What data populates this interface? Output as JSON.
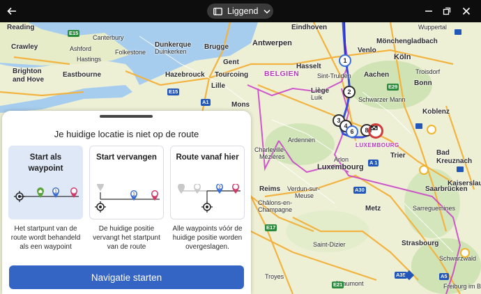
{
  "titlebar": {
    "orientation_label": "Liggend"
  },
  "map": {
    "cities": [
      "Reading",
      "Crawley",
      "Brighton and Hove",
      "Eastbourne",
      "Canterbury",
      "Ashford",
      "Folkestone",
      "Hastings",
      "Dunkerque",
      "Duinkerken",
      "Brugge",
      "Gent",
      "Antwerpen",
      "Eindhoven",
      "Venlo",
      "Mönchengladbach",
      "Köln",
      "Hasselt",
      "Aachen",
      "Sint-Truiden",
      "Liège",
      "Luik",
      "Troisdorf",
      "Bonn",
      "Hazebrouck",
      "Tourcoing",
      "Lille",
      "Mons",
      "Koblenz",
      "Charleville-Mézières",
      "Arlon",
      "Trier",
      "Bad Kreuznach",
      "Luxembourg",
      "Kaiserslautern",
      "Reims",
      "Verdun-sur-Meuse",
      "Metz",
      "Saarbrücken",
      "Châlons-en-Champagne",
      "Saint-Dizier",
      "Strasbourg",
      "Troyes",
      "Chaumont",
      "Schwarzwald",
      "Freiburg im Breisgau",
      "Wuppertal",
      "Sarreguemines",
      "Ardennen",
      "Schwarzer Mann"
    ],
    "countries": [
      "BELGIEN",
      "LUXEMBOURG"
    ],
    "roads": [
      "E15",
      "E15",
      "A1",
      "A1",
      "E29",
      "E17",
      "E21",
      "A30",
      "A5",
      "A 1",
      "A35"
    ],
    "waypoints": [
      "1",
      "2",
      "3",
      "4",
      "6",
      "8"
    ]
  },
  "panel": {
    "title": "Je huidige locatie is niet op de route",
    "options": [
      {
        "title": "Start als waypoint",
        "description": "Het startpunt van de route wordt behandeld als een waypoint",
        "selected": true
      },
      {
        "title": "Start vervangen",
        "description": "De huidige positie vervangt het startpunt van de route",
        "selected": false
      },
      {
        "title": "Route vanaf hier",
        "description": "Alle waypoints vóór de huidige positie worden overgeslagen.",
        "selected": false
      }
    ],
    "diagram_labels": [
      "1",
      "1",
      "2"
    ],
    "start_button": "Navigatie starten"
  },
  "colors": {
    "accent": "#3464c4",
    "selected_card": "#dfe8f7",
    "route": "#3a4fd8",
    "border": "#c93cc9"
  }
}
